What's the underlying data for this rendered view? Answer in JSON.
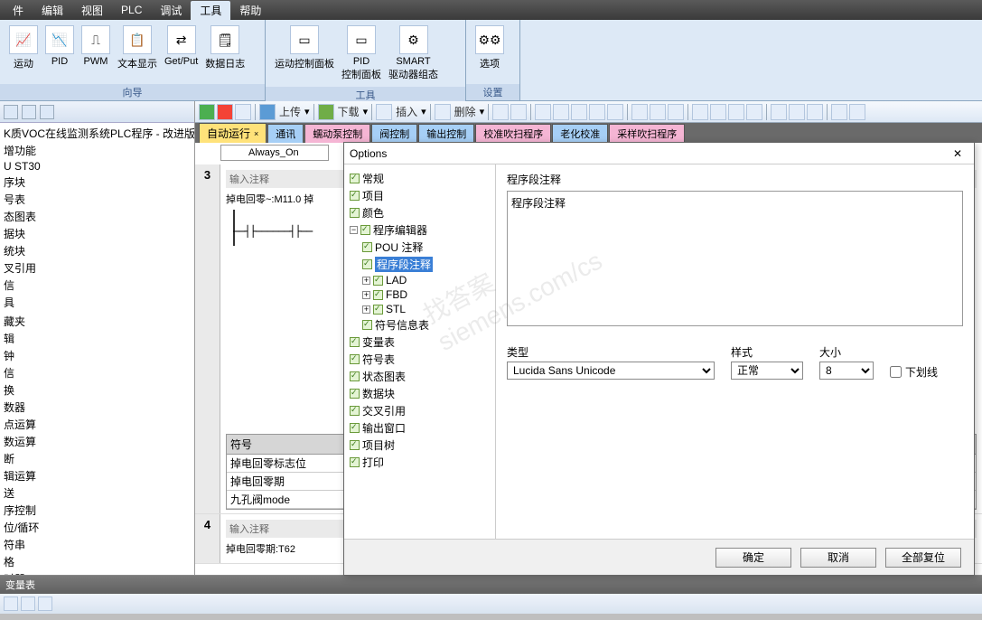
{
  "menu": {
    "items": [
      "件",
      "编辑",
      "视图",
      "PLC",
      "调试",
      "工具",
      "帮助"
    ],
    "active": 5
  },
  "ribbon": {
    "group1": {
      "caption": "向导",
      "items": [
        "运动",
        "PID",
        "PWM",
        "文本显示",
        "Get/Put",
        "数据日志"
      ]
    },
    "group2": {
      "caption": "工具",
      "items": [
        "运动控制面板",
        "PID\n控制面板",
        "SMART\n驱动器组态"
      ]
    },
    "group3": {
      "caption": "设置",
      "items": [
        "选项"
      ]
    }
  },
  "project": {
    "title": "K质VOC在线监测系统PLC程序 - 改进版 (I",
    "tree": [
      "增功能",
      "U ST30",
      "序块",
      "号表",
      "态图表",
      "据块",
      "统块",
      "叉引用",
      "信",
      "具",
      "",
      "藏夹",
      "辑",
      "钟",
      "信",
      "换",
      "数器",
      "点运算",
      "数运算",
      "断",
      "辑运算",
      "送",
      "序控制",
      "位/循环",
      "符串",
      "格",
      "时器"
    ]
  },
  "edittoolbar": {
    "upload": "上传",
    "download": "下载",
    "insert": "插入",
    "delete": "删除"
  },
  "tabs": [
    {
      "label": "自动运行",
      "cls": "active",
      "close": true
    },
    {
      "label": "通讯",
      "cls": "blue"
    },
    {
      "label": "蠕动泵控制",
      "cls": "pink"
    },
    {
      "label": "阀控制",
      "cls": "blue"
    },
    {
      "label": "输出控制",
      "cls": "blue"
    },
    {
      "label": "校准吹扫程序",
      "cls": "pink"
    },
    {
      "label": "老化校准",
      "cls": "blue"
    },
    {
      "label": "采样吹扫程序",
      "cls": "pink"
    }
  ],
  "editor": {
    "always": "Always_On",
    "rung3": {
      "num": "3",
      "comment": "输入注释",
      "contact": "掉电回零~:M11.0   掉"
    },
    "symtable": {
      "hdr": "符号",
      "rows": [
        "掉电回零标志位",
        "掉电回零期",
        "九孔阀mode"
      ]
    },
    "rung4": {
      "num": "4",
      "comment": "输入注释",
      "note": "掉电回零期:T62"
    }
  },
  "bottom": {
    "title": "变量表"
  },
  "dialog": {
    "title": "Options",
    "tree": {
      "items": [
        "常规",
        "项目",
        "颜色",
        "程序编辑器"
      ],
      "editor_children": [
        "POU 注释",
        "程序段注释",
        "LAD",
        "FBD",
        "STL",
        "符号信息表"
      ],
      "items2": [
        "变量表",
        "符号表",
        "状态图表",
        "数据块",
        "交叉引用",
        "输出窗口",
        "项目树",
        "打印"
      ],
      "editor_sel": 1
    },
    "main": {
      "section": "程序段注释",
      "textarea": "程序段注释",
      "type_label": "类型",
      "type_value": "Lucida Sans Unicode",
      "style_label": "样式",
      "style_value": "正常",
      "size_label": "大小",
      "size_value": "8",
      "underline": "下划线"
    },
    "buttons": {
      "ok": "确定",
      "cancel": "取消",
      "reset": "全部复位"
    }
  },
  "watermark": "找答案\nsiemens.com/cs"
}
